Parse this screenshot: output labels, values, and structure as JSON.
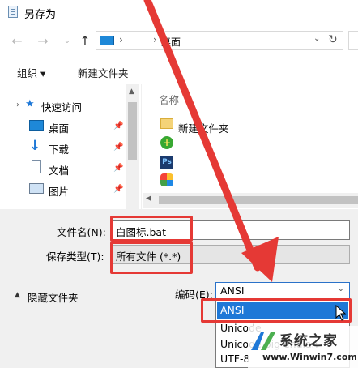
{
  "window": {
    "title": "另存为"
  },
  "address": {
    "crumb": "桌面",
    "separator": "›"
  },
  "toolbar": {
    "organize": "组织 ▾",
    "new_folder": "新建文件夹"
  },
  "nav": {
    "quick_access": "快速访问",
    "items": [
      {
        "label": "桌面",
        "icon": "desktop-icon"
      },
      {
        "label": "下载",
        "icon": "download-icon"
      },
      {
        "label": "文档",
        "icon": "document-icon"
      },
      {
        "label": "图片",
        "icon": "picture-icon"
      }
    ]
  },
  "files": {
    "column_name": "名称",
    "new_folder_item": "新建文件夹"
  },
  "form": {
    "filename_label": "文件名(N):",
    "filename_value": "白图标.bat",
    "savetype_label": "保存类型(T):",
    "savetype_value": "所有文件  (*.*)",
    "hide_folders": "隐藏文件夹",
    "encoding_label": "编码(E):",
    "encoding_value": "ANSI"
  },
  "encoding_options": [
    "ANSI",
    "Unicode",
    "Unicode big endian",
    "UTF-8"
  ],
  "watermark": {
    "title": "系统之家",
    "url": "www.Winwin7.com"
  },
  "colors": {
    "accent": "#1e78d7",
    "annotation": "#e53935"
  }
}
